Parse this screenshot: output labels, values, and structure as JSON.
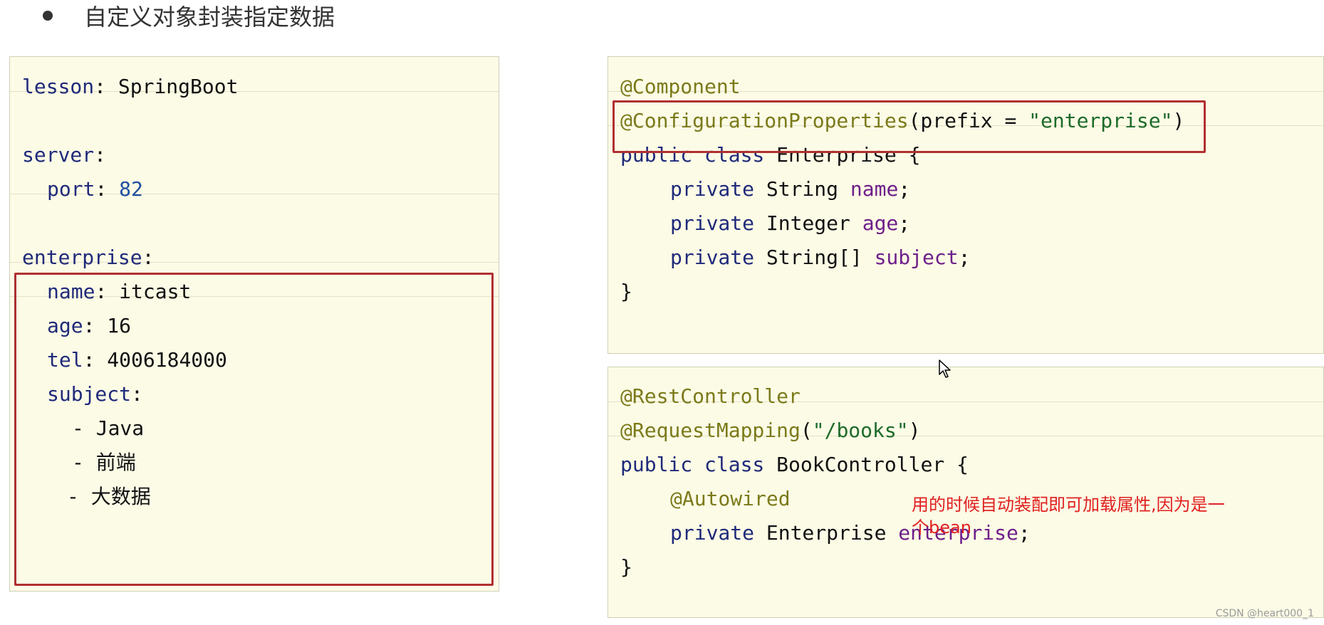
{
  "title": "自定义对象封装指定数据",
  "yaml": {
    "lines": [
      {
        "key": "lesson",
        "sep": ": ",
        "value": "SpringBoot"
      },
      {
        "key": "server",
        "sep": ":",
        "value": ""
      },
      {
        "key": "port",
        "sep": ": ",
        "value": "82"
      },
      {
        "key": "enterprise",
        "sep": ":",
        "value": ""
      },
      {
        "key": "name",
        "sep": ": ",
        "value": "itcast"
      },
      {
        "key": "age",
        "sep": ": ",
        "value": "16"
      },
      {
        "key": "tel",
        "sep": ": ",
        "value": "4006184000"
      },
      {
        "key": "subject",
        "sep": ":",
        "value": ""
      },
      {
        "dash": "- ",
        "value": "Java"
      },
      {
        "dash": "- ",
        "value": "前端"
      },
      {
        "dash": "- ",
        "value": "大数据"
      }
    ]
  },
  "java_class": {
    "annotation1": "@Component",
    "annotation2": "@ConfigurationProperties",
    "annotation2_open": "(prefix = ",
    "annotation2_str": "\"enterprise\"",
    "annotation2_close": ")",
    "decl_kw": "public class ",
    "decl_name": "Enterprise {",
    "fields": [
      {
        "kw": "private ",
        "type": "String ",
        "name": "name",
        "end": ";"
      },
      {
        "kw": "private ",
        "type": "Integer ",
        "name": "age",
        "end": ";"
      },
      {
        "kw": "private ",
        "type": "String[] ",
        "name": "subject",
        "end": ";"
      }
    ],
    "close": "}"
  },
  "java_controller": {
    "annotation1": "@RestController",
    "annotation2": "@RequestMapping",
    "annotation2_open": "(",
    "annotation2_str": "\"/books\"",
    "annotation2_close": ")",
    "decl_kw": "public class ",
    "decl_name": "BookController {",
    "autowired": "@Autowired",
    "field_kw": "private ",
    "field_type": "Enterprise ",
    "field_name": "enterprise",
    "field_end": ";",
    "close": "}"
  },
  "note": "用的时候自动装配即可加载属性,因为是一个bean",
  "watermark": "CSDN @heart000_1",
  "colors": {
    "panel_bg": "#fcfbe6",
    "highlight_border": "#b03030",
    "note_color": "#e02020",
    "keyword": "#1f2a7a",
    "annotation": "#7b7a1a",
    "string": "#1d6b2a",
    "field": "#6e1f8a"
  }
}
